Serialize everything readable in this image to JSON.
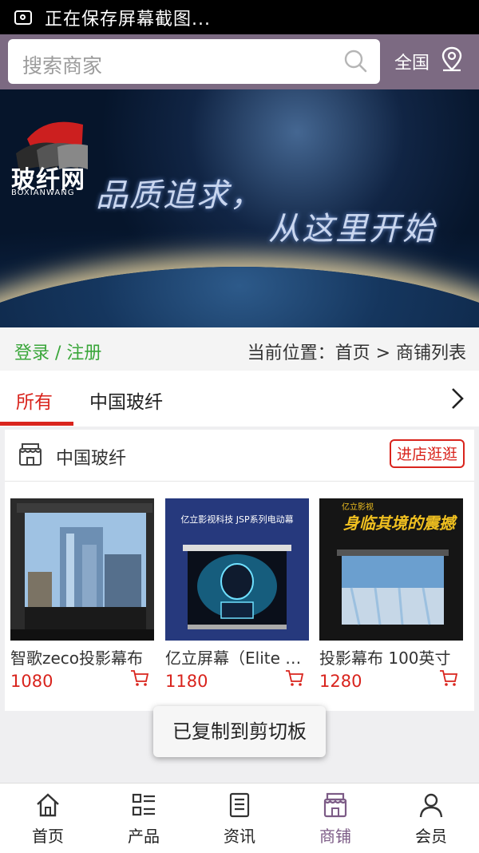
{
  "status_bar": {
    "text": "正在保存屏幕截图..."
  },
  "search": {
    "placeholder": "搜索商家",
    "region_label": "全国"
  },
  "banner": {
    "logo_cn": "玻纤网",
    "logo_en": "BOXIANWANG",
    "slogan_line1": "品质追求，",
    "slogan_line2": "从这里开始"
  },
  "crumb_bar": {
    "login_register": "登录 / 注册",
    "location": "当前位置：首页 > 商铺列表"
  },
  "tabs": [
    {
      "label": "所有",
      "active": true
    },
    {
      "label": "中国玻纤",
      "active": false
    }
  ],
  "shop": {
    "name": "中国玻纤",
    "enter_label": "进店逛逛",
    "products": [
      {
        "name": "智歌zeco投影幕布",
        "price": "1080",
        "image": "projector-screen-building"
      },
      {
        "name": "亿立屏幕（Elite Screens）",
        "price": "1180",
        "image": "projector-screen-tron"
      },
      {
        "name": "投影幕布 100英寸",
        "price": "1280",
        "image": "projector-screen-waterfall"
      }
    ],
    "product_image_texts": {
      "p2_title": "亿立影视科技  JSP系列电动幕",
      "p3_slogan": "身临其境的震撼",
      "p3_brand": "亿立影视"
    }
  },
  "toast": "已复制到剪切板",
  "bottom_nav": [
    {
      "label": "首页",
      "icon": "home-icon",
      "active": false
    },
    {
      "label": "产品",
      "icon": "grid-list-icon",
      "active": false
    },
    {
      "label": "资讯",
      "icon": "document-icon",
      "active": false
    },
    {
      "label": "商铺",
      "icon": "store-icon",
      "active": true
    },
    {
      "label": "会员",
      "icon": "user-icon",
      "active": false
    }
  ],
  "colors": {
    "header": "#7c6a82",
    "accent": "#d9241d",
    "login": "#3aa63a",
    "nav_active": "#7c5b86"
  }
}
